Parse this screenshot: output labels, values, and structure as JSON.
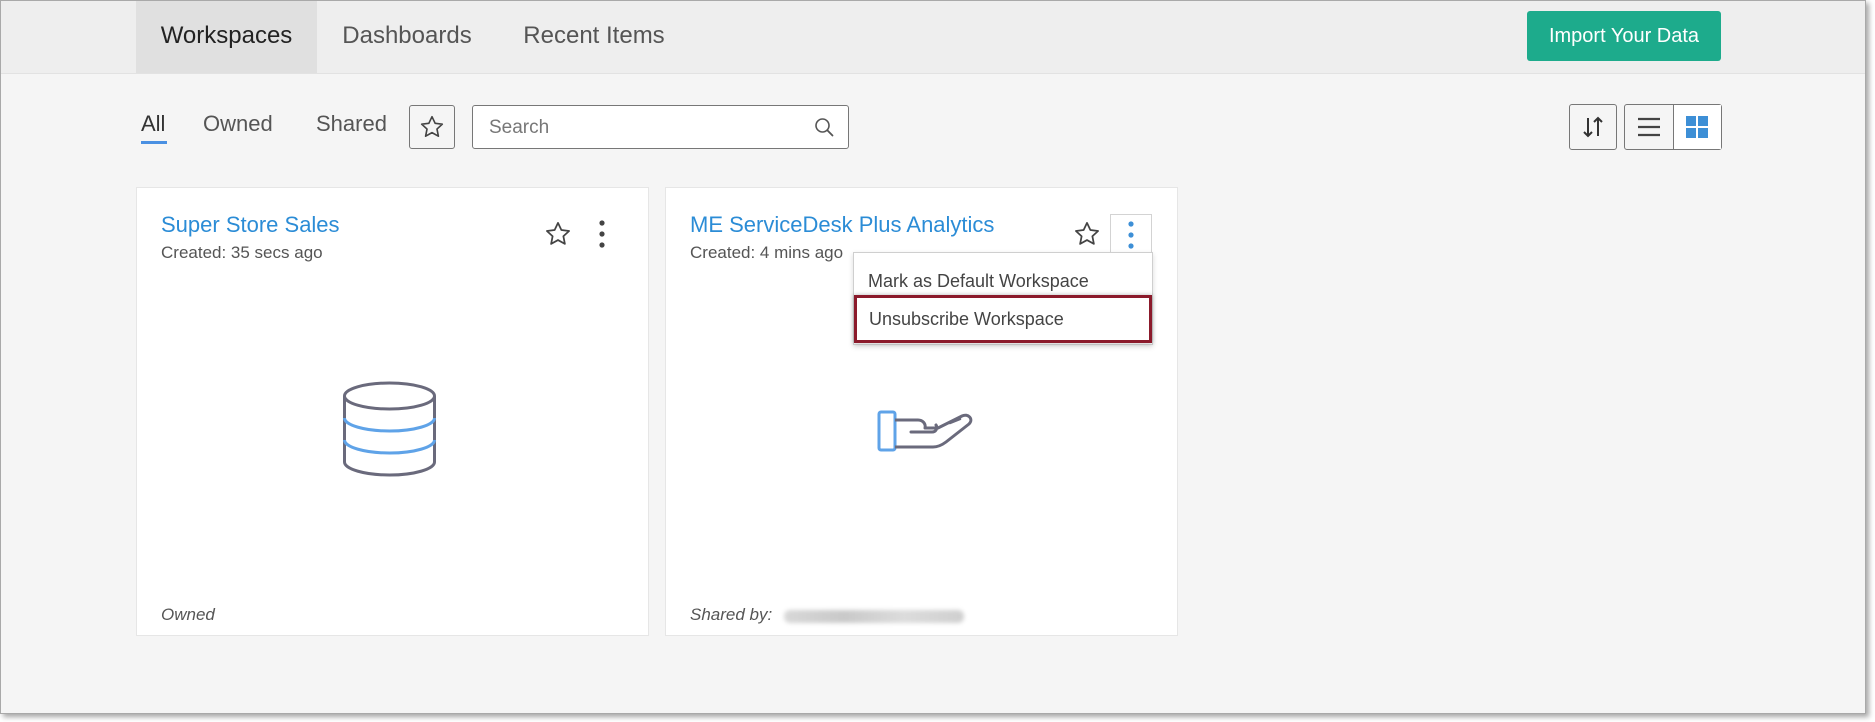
{
  "nav": {
    "tabs": [
      {
        "label": "Workspaces",
        "active": true
      },
      {
        "label": "Dashboards",
        "active": false
      },
      {
        "label": "Recent Items",
        "active": false
      }
    ],
    "import_button": "Import Your Data"
  },
  "filters": {
    "items": [
      "All",
      "Owned",
      "Shared"
    ],
    "active": "All"
  },
  "search": {
    "placeholder": "Search",
    "value": ""
  },
  "view": {
    "mode": "grid"
  },
  "workspaces": [
    {
      "title": "Super Store Sales",
      "created": "Created: 35 secs ago",
      "icon": "database-icon",
      "owner_label": "Owned"
    },
    {
      "title": "ME ServiceDesk Plus Analytics",
      "created": "Created: 4 mins ago",
      "icon": "shared-hand-icon",
      "owner_label": "Shared by:"
    }
  ],
  "context_menu": {
    "items": [
      "Mark as Default Workspace",
      "Unsubscribe Workspace"
    ],
    "highlighted": "Unsubscribe Workspace"
  },
  "colors": {
    "accent_button": "#1dab8c",
    "link": "#2b8cd6",
    "highlight_border": "#8b1a2b",
    "active_underline": "#4a90e2"
  }
}
